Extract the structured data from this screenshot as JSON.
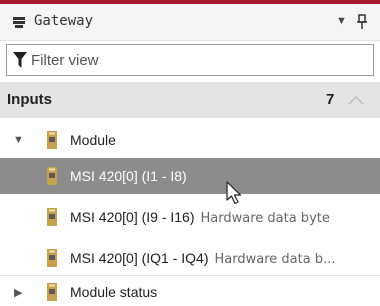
{
  "panel": {
    "title": "Gateway",
    "colors": {
      "accent": "#a6192e",
      "selected_row": "#8c8c8c",
      "section_header_bg": "#e4e4e4",
      "module_icon": "#c8a24a"
    }
  },
  "filter": {
    "placeholder": "Filter view"
  },
  "inputs": {
    "label": "Inputs",
    "count": "7",
    "groups": [
      {
        "label": "Module",
        "expanded": true,
        "items": [
          {
            "name": "MSI 420[0] (I1 - I8)",
            "detail": "",
            "selected": true
          },
          {
            "name": "MSI 420[0] (I9 - I16)",
            "detail": "Hardware data byte",
            "selected": false
          },
          {
            "name": "MSI 420[0] (IQ1 - IQ4)",
            "detail": "Hardware data b...",
            "selected": false
          }
        ]
      },
      {
        "label": "Module status",
        "expanded": false
      }
    ]
  }
}
